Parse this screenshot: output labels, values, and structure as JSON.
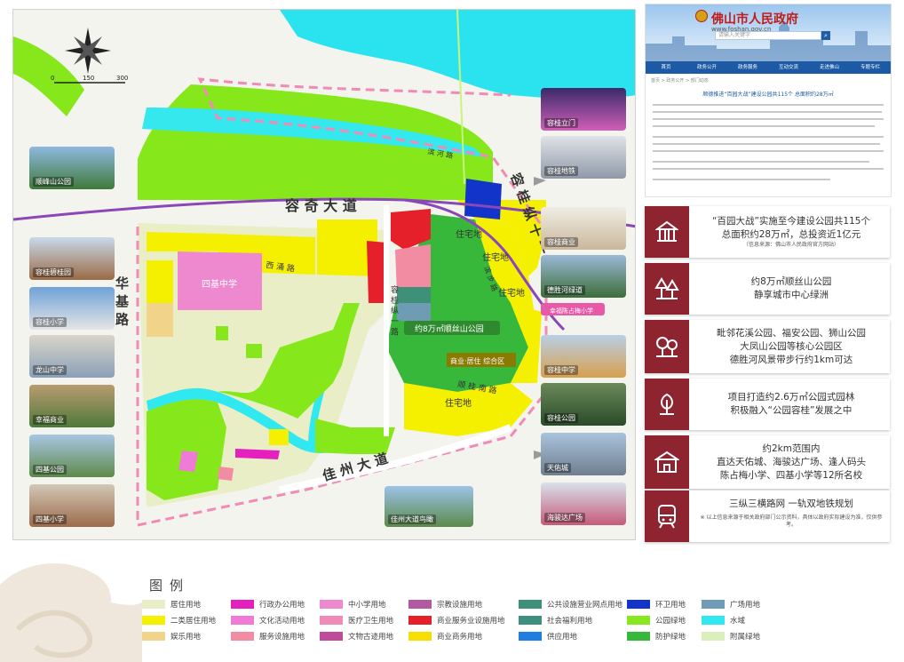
{
  "map": {
    "scale": {
      "zero": "0",
      "mid": "150",
      "max": "300"
    },
    "roads": {
      "rongqi_avenue": "容 奇 大 道",
      "jiazhou_avenue": "佳 州 大 道",
      "huaji_road": "华 基 路",
      "ronggui_ring11": "容 桂 纵 十 一 路",
      "ronggui_ring1": "容 桂 纵 一 路",
      "xisa_road": "西 涌 路",
      "shunsheng_road": "顺 桂 南 路",
      "binhe_road": "滨 河 路",
      "binbu_road": "滨 步 路"
    },
    "labels": {
      "school": "四基中学",
      "park": "约8万㎡顺丝山公园",
      "residential_1": "住宅地",
      "residential_2": "住宅地",
      "residential_3": "住宅地",
      "residential_4": "住宅地",
      "commercial": "商业·居住 综合区",
      "kindergarten": "幸福陈占梅小学"
    },
    "thumbs_left": [
      {
        "cap": "顺峰山公园"
      },
      {
        "cap": "容桂碧桂园"
      },
      {
        "cap": "容桂小学"
      },
      {
        "cap": "龙山中学"
      },
      {
        "cap": "幸福商业"
      },
      {
        "cap": "四基公园"
      },
      {
        "cap": "四基小学"
      }
    ],
    "thumbs_right": [
      {
        "cap": "容桂立门"
      },
      {
        "cap": "容桂地铁"
      },
      {
        "cap": "容桂商业"
      },
      {
        "cap": "德胜河绿道"
      },
      {
        "cap": "幸福陈占梅小学"
      },
      {
        "cap": "容桂中学"
      },
      {
        "cap": "容桂公园"
      },
      {
        "cap": "天佑城"
      },
      {
        "cap": "海骏达广场"
      }
    ],
    "thumb_bottom": {
      "cap": "佳州大道鸟瞰"
    }
  },
  "gov": {
    "title": "佛山市人民政府",
    "url": "www.foshan.gov.cn",
    "search_placeholder": "请输入关键字",
    "nav": [
      "首页",
      "政务公开",
      "政务服务",
      "互动交流",
      "走进佛山",
      "专题专栏"
    ],
    "crumb": "首页 > 政务公开 > 部门动态",
    "headline": "顺德推进“百园大战”建设公园共115个 总面积约28万㎡"
  },
  "cards": [
    {
      "line1": "“百园大战”实施至今建设公园共115个",
      "line2": "总面积约28万㎡，总投资近1亿元",
      "small": "（信息来源：佛山市人民政府官方网站）",
      "icon": "pavilion-icon"
    },
    {
      "line1": "约8万㎡顺丝山公园",
      "line2": "静享城市中心绿洲",
      "icon": "trees-icon"
    },
    {
      "line1": "毗邻花溪公园、福安公园、狮山公园",
      "line2": "大凤山公园等核心公园区",
      "line3": "德胜河风景带步行约1km可达",
      "icon": "park-icon"
    },
    {
      "line1": "项目打造约2.6万㎡公园式园林",
      "line2": "积极融入“公园容桂”发展之中",
      "icon": "garden-icon"
    },
    {
      "line1": "约2km范围内",
      "line2": "直达天佑城、海骏达广场、逢人码头",
      "line3": "陈占梅小学、四基小学等12所名校",
      "icon": "school-icon"
    },
    {
      "line1": "三纵三横路网  一轨双地铁规划",
      "small": "※ 以上信息来源于相关政府部门公示资料，具体以政府实际建设为准，仅供参考。",
      "icon": "metro-icon"
    }
  ],
  "legend": {
    "title": "图例",
    "items": [
      {
        "label": "居住用地",
        "color": "#e9eec6"
      },
      {
        "label": "二类居住用地",
        "color": "#f4f000"
      },
      {
        "label": "娱乐用地",
        "color": "#f2d38a"
      },
      {
        "label": "行政办公用地",
        "color": "#e61fbf"
      },
      {
        "label": "文化活动用地",
        "color": "#f07bd7"
      },
      {
        "label": "服务设施用地",
        "color": "#f28ca3"
      },
      {
        "label": "中小学用地",
        "color": "#ee88cf"
      },
      {
        "label": "医疗卫生用地",
        "color": "#f08ab6"
      },
      {
        "label": "文物古迹用地",
        "color": "#c04b9b"
      },
      {
        "label": "宗教设施用地",
        "color": "#b25aa0"
      },
      {
        "label": "商业服务业设施用地",
        "color": "#e5202a"
      },
      {
        "label": "商业商务用地",
        "color": "#f7dd00"
      },
      {
        "label": "公共设施营业网点用地",
        "color": "#3e9178"
      },
      {
        "label": "社会福利用地",
        "color": "#3e8f7e"
      },
      {
        "label": "供应用地",
        "color": "#1f7ee0"
      },
      {
        "label": "环卫用地",
        "color": "#1234c8"
      },
      {
        "label": "公园绿地",
        "color": "#88e81d"
      },
      {
        "label": "防护绿地",
        "color": "#38b83a"
      },
      {
        "label": "广场用地",
        "color": "#6f9cb4"
      },
      {
        "label": "水域",
        "color": "#2fe8f0"
      },
      {
        "label": "附属绿地",
        "color": "#d9f0bd"
      }
    ]
  }
}
